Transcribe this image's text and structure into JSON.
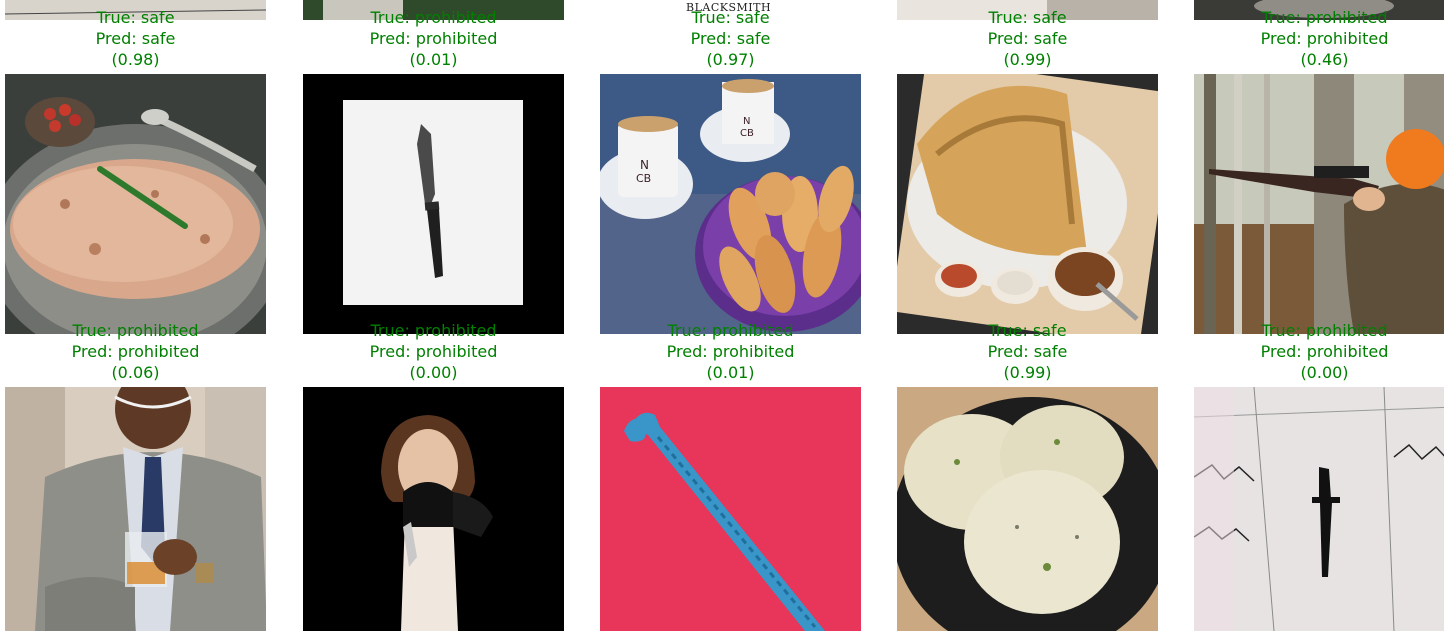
{
  "figure": {
    "caption_color": "#008000",
    "rows": [
      {
        "cells": [
          {
            "true_label": "True: safe",
            "pred_label": "Pred: safe",
            "score": "(0.98)"
          },
          {
            "true_label": "True: prohibited",
            "pred_label": "Pred: prohibited",
            "score": "(0.01)"
          },
          {
            "true_label": "True: safe",
            "pred_label": "Pred: safe",
            "score": "(0.97)"
          },
          {
            "true_label": "True: safe",
            "pred_label": "Pred: safe",
            "score": "(0.99)"
          },
          {
            "true_label": "True: prohibited",
            "pred_label": "Pred: prohibited",
            "score": "(0.46)"
          }
        ]
      },
      {
        "cells": [
          {
            "true_label": "True: prohibited",
            "pred_label": "Pred: prohibited",
            "score": "(0.06)"
          },
          {
            "true_label": "True: prohibited",
            "pred_label": "Pred: prohibited",
            "score": "(0.00)"
          },
          {
            "true_label": "True: prohibited",
            "pred_label": "Pred: prohibited",
            "score": "(0.01)"
          },
          {
            "true_label": "True: safe",
            "pred_label": "Pred: safe",
            "score": "(0.99)"
          },
          {
            "true_label": "True: prohibited",
            "pred_label": "Pred: prohibited",
            "score": "(0.00)"
          }
        ]
      }
    ],
    "partial_top_text": "BLACKSMITH"
  }
}
